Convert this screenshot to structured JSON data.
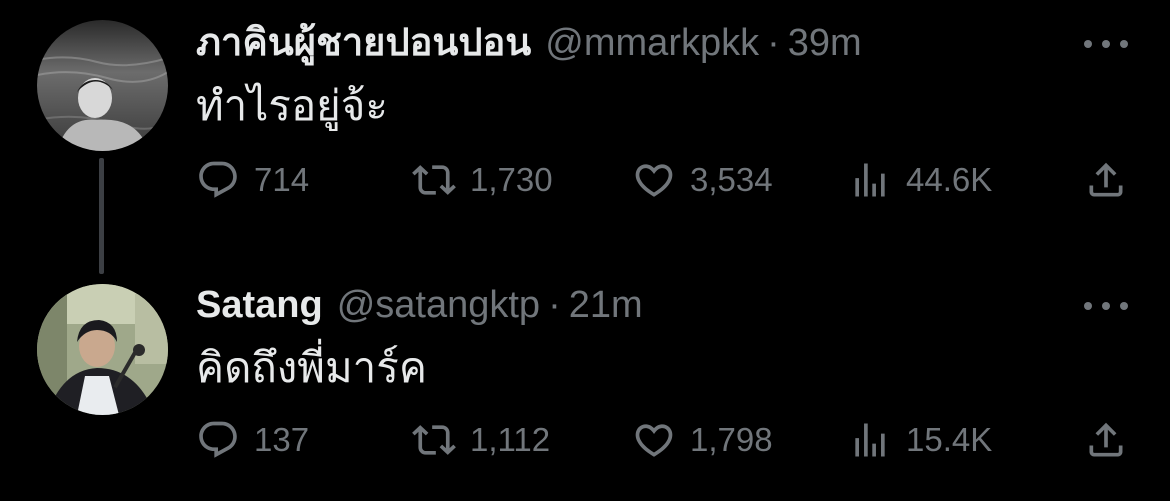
{
  "tweets": [
    {
      "display_name": "ภาคินผู้ชายปอนปอน",
      "handle": "@mmarkpkk",
      "separator": "·",
      "time": "39m",
      "text": "ทำไรอยู่จ้ะ",
      "replies": "714",
      "retweets": "1,730",
      "likes": "3,534",
      "views": "44.6K"
    },
    {
      "display_name": "Satang",
      "handle": "@satangktp",
      "separator": "·",
      "time": "21m",
      "text": "คิดถึงพี่มาร์ค",
      "replies": "137",
      "retweets": "1,112",
      "likes": "1,798",
      "views": "15.4K"
    }
  ],
  "icons": {
    "reply": "reply-icon",
    "retweet": "retweet-icon",
    "like": "heart-icon",
    "views": "views-icon",
    "share": "share-icon",
    "more": "more-icon"
  },
  "colors": {
    "background": "#000000",
    "primary_text": "#e7e9ea",
    "secondary_text": "#71767b",
    "thread_line": "#3c3f44"
  }
}
